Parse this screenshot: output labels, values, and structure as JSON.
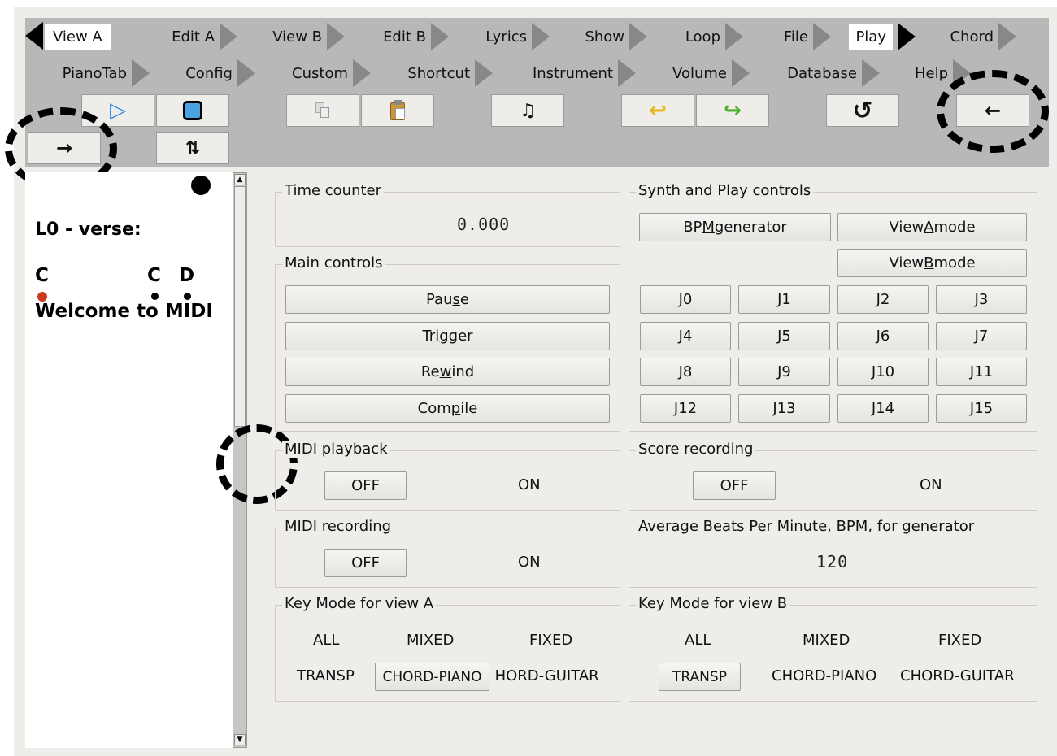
{
  "tabs_row1": [
    {
      "label": "View A",
      "active": false,
      "selected_white": true
    },
    {
      "label": "Edit A"
    },
    {
      "label": "View B"
    },
    {
      "label": "Edit B"
    },
    {
      "label": "Lyrics"
    },
    {
      "label": "Show"
    },
    {
      "label": "Loop"
    },
    {
      "label": "File"
    },
    {
      "label": "Play",
      "active": true
    },
    {
      "label": "Chord"
    }
  ],
  "tabs_row2": [
    {
      "label": "PianoTab"
    },
    {
      "label": "Config"
    },
    {
      "label": "Custom"
    },
    {
      "label": "Shortcut"
    },
    {
      "label": "Instrument"
    },
    {
      "label": "Volume"
    },
    {
      "label": "Database"
    },
    {
      "label": "Help"
    }
  ],
  "toolbar": {
    "play_icon": "play-icon",
    "stop_icon": "stop-icon",
    "copy_icon": "copy-icon",
    "paste_icon": "paste-icon",
    "notes_icon": "notes-icon",
    "undo_icon": "undo-icon",
    "redo_icon": "redo-icon",
    "rewind_icon": "loop-back-icon",
    "back_icon": "arrow-left-icon",
    "forward_icon": "arrow-right-icon",
    "swap_icon": "swap-arrows-icon",
    "play_glyph": "▷",
    "notes_glyph": "♫",
    "undo_glyph": "↩",
    "redo_glyph": "↪",
    "back_glyph": "←",
    "forward_glyph": "→",
    "swap_glyph": "⇅",
    "rewind_glyph": "↺"
  },
  "song": {
    "heading": "L0 - verse:",
    "chord1": "C",
    "chord2": "C",
    "chord3": "D",
    "lyric": "Welcome to MIDI"
  },
  "time_counter": {
    "title": "Time counter",
    "value": "0.000"
  },
  "main_controls": {
    "title": "Main controls",
    "pause": {
      "pre": "Pau",
      "u": "s",
      "post": "e"
    },
    "trigger": {
      "pre": "Tri",
      "u": "g",
      "post": "ger"
    },
    "rewind": {
      "pre": "Re",
      "u": "w",
      "post": "ind"
    },
    "compile": {
      "pre": "Com",
      "u": "p",
      "post": "ile"
    }
  },
  "synth": {
    "title": "Synth and Play controls",
    "bpm": {
      "pre": "BP",
      "u": "M",
      "post": " generator"
    },
    "view_a": {
      "pre": "View ",
      "u": "A",
      "post": " mode"
    },
    "view_b": {
      "pre": "View ",
      "u": "B",
      "post": " mode"
    },
    "jumps": [
      "J0",
      "J1",
      "J2",
      "J3",
      "J4",
      "J5",
      "J6",
      "J7",
      "J8",
      "J9",
      "J10",
      "J11",
      "J12",
      "J13",
      "J14",
      "J15"
    ]
  },
  "midi_playback": {
    "title": "MIDI playback",
    "off": "OFF",
    "on": "ON"
  },
  "score_recording": {
    "title": "Score recording",
    "off": "OFF",
    "on": "ON"
  },
  "midi_recording": {
    "title": "MIDI recording",
    "off": "OFF",
    "on": "ON"
  },
  "avg_bpm": {
    "title": "Average Beats Per Minute, BPM, for generator",
    "value": "120"
  },
  "key_mode_a": {
    "title": "Key Mode for view A",
    "options": [
      "ALL",
      "MIXED",
      "FIXED",
      "TRANSP",
      "CHORD-PIANO",
      "CHORD-GUITAR"
    ],
    "selected": "CHORD-PIANO"
  },
  "key_mode_b": {
    "title": "Key Mode for view B",
    "options": [
      "ALL",
      "MIXED",
      "FIXED",
      "TRANSP",
      "CHORD-PIANO",
      "CHORD-GUITAR"
    ],
    "selected": "TRANSP"
  },
  "colors": {
    "toolbar_bg": "#b8b8b8",
    "panel_bg": "#efedea",
    "accent_blue": "#4aa3e0",
    "chord_dot": "#c83c1e"
  }
}
